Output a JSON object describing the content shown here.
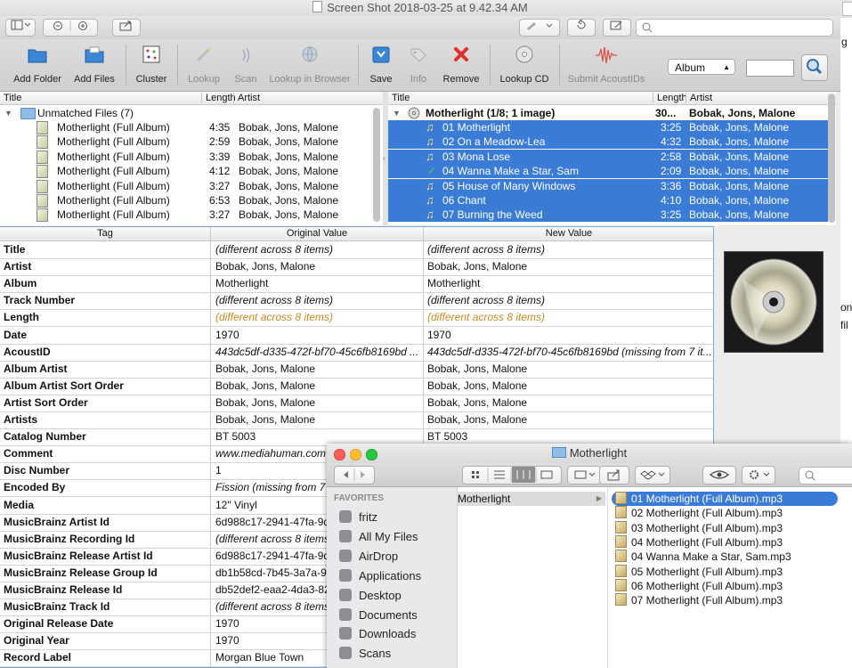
{
  "window": {
    "title": "Screen Shot 2018-03-25 at 9.42.34 AM"
  },
  "toolbar": {
    "add_folder": "Add Folder",
    "add_files": "Add Files",
    "cluster": "Cluster",
    "lookup": "Lookup",
    "scan": "Scan",
    "lookup_browser": "Lookup in Browser",
    "save": "Save",
    "info": "Info",
    "remove": "Remove",
    "lookup_cd": "Lookup CD",
    "submit": "Submit AcoustIDs",
    "album_select": "Album",
    "accent": "#3a7bd5"
  },
  "left_pane": {
    "col_title": "Title",
    "col_length": "Length",
    "col_artist": "Artist",
    "group": "Unmatched Files (7)",
    "rows": [
      {
        "title": "Motherlight (Full Album)",
        "length": "4:35",
        "artist": "Bobak, Jons, Malone"
      },
      {
        "title": "Motherlight (Full Album)",
        "length": "2:59",
        "artist": "Bobak, Jons, Malone"
      },
      {
        "title": "Motherlight (Full Album)",
        "length": "3:39",
        "artist": "Bobak, Jons, Malone"
      },
      {
        "title": "Motherlight (Full Album)",
        "length": "4:12",
        "artist": "Bobak, Jons, Malone"
      },
      {
        "title": "Motherlight (Full Album)",
        "length": "3:27",
        "artist": "Bobak, Jons, Malone"
      },
      {
        "title": "Motherlight (Full Album)",
        "length": "6:53",
        "artist": "Bobak, Jons, Malone"
      },
      {
        "title": "Motherlight (Full Album)",
        "length": "3:27",
        "artist": "Bobak, Jons, Malone"
      }
    ]
  },
  "right_pane": {
    "col_title": "Title",
    "col_length": "Length",
    "col_artist": "Artist",
    "album": {
      "title": "Motherlight (1/8; 1 image)",
      "length": "30...",
      "artist": "Bobak, Jons, Malone"
    },
    "tracks": [
      {
        "title": "01  Motherlight",
        "length": "3:25",
        "artist": "Bobak, Jons, Malone",
        "status": "note"
      },
      {
        "title": "02  On a Meadow-Lea",
        "length": "4:32",
        "artist": "Bobak, Jons, Malone",
        "status": "note"
      },
      {
        "title": "03  Mona Lose",
        "length": "2:58",
        "artist": "Bobak, Jons, Malone",
        "status": "note"
      },
      {
        "title": "04  Wanna Make a Star, Sam",
        "length": "2:09",
        "artist": "Bobak, Jons, Malone",
        "status": "check"
      },
      {
        "title": "05  House of Many Windows",
        "length": "3:36",
        "artist": "Bobak, Jons, Malone",
        "status": "note"
      },
      {
        "title": "06  Chant",
        "length": "4:10",
        "artist": "Bobak, Jons, Malone",
        "status": "note"
      },
      {
        "title": "07  Burning the Weed",
        "length": "3:25",
        "artist": "Bobak, Jons, Malone",
        "status": "note"
      }
    ]
  },
  "tag_table": {
    "col_tag": "Tag",
    "col_original": "Original Value",
    "col_new": "New Value",
    "rows": [
      {
        "tag": "Title",
        "original": "(different across 8 items)",
        "new": "(different across 8 items)",
        "style": "it"
      },
      {
        "tag": "Artist",
        "original": "Bobak, Jons, Malone",
        "new": "Bobak, Jons, Malone",
        "style": ""
      },
      {
        "tag": "Album",
        "original": "Motherlight",
        "new": "Motherlight",
        "style": ""
      },
      {
        "tag": "Track Number",
        "original": "(different across 8 items)",
        "new": "(different across 8 items)",
        "style": "it"
      },
      {
        "tag": "Length",
        "original": "(different across 8 items)",
        "new": "(different across 8 items)",
        "style": "it orange"
      },
      {
        "tag": "Date",
        "original": "1970",
        "new": "1970",
        "style": ""
      },
      {
        "tag": "AcoustID",
        "original": "443dc5df-d335-472f-bf70-45c6fb8169bd ...",
        "new": "443dc5df-d335-472f-bf70-45c6fb8169bd (missing from 7 it...",
        "style": "it"
      },
      {
        "tag": "Album Artist",
        "original": "Bobak, Jons, Malone",
        "new": "Bobak, Jons, Malone",
        "style": ""
      },
      {
        "tag": "Album Artist Sort Order",
        "original": "Bobak, Jons, Malone",
        "new": "Bobak, Jons, Malone",
        "style": ""
      },
      {
        "tag": "Artist Sort Order",
        "original": "Bobak, Jons, Malone",
        "new": "Bobak, Jons, Malone",
        "style": ""
      },
      {
        "tag": "Artists",
        "original": "Bobak, Jons, Malone",
        "new": "Bobak, Jons, Malone",
        "style": ""
      },
      {
        "tag": "Catalog Number",
        "original": "BT 5003",
        "new": "BT 5003",
        "style": ""
      },
      {
        "tag": "Comment",
        "original": "www.mediahuman.com",
        "new": "",
        "style": "it"
      },
      {
        "tag": "Disc Number",
        "original": "1",
        "new": "",
        "style": ""
      },
      {
        "tag": "Encoded By",
        "original": "Fission (missing from 7",
        "new": "",
        "style": "it"
      },
      {
        "tag": "Media",
        "original": "12\" Vinyl",
        "new": "",
        "style": ""
      },
      {
        "tag": "MusicBrainz Artist Id",
        "original": "6d988c17-2941-47fa-9d",
        "new": "",
        "style": ""
      },
      {
        "tag": "MusicBrainz Recording Id",
        "original": "(different across 8 items",
        "new": "",
        "style": "it"
      },
      {
        "tag": "MusicBrainz Release Artist Id",
        "original": "6d988c17-2941-47fa-9d",
        "new": "",
        "style": ""
      },
      {
        "tag": "MusicBrainz Release Group Id",
        "original": "db1b58cd-7b45-3a7a-9",
        "new": "",
        "style": ""
      },
      {
        "tag": "MusicBrainz Release Id",
        "original": "db52def2-eaa2-4da3-82",
        "new": "",
        "style": ""
      },
      {
        "tag": "MusicBrainz Track Id",
        "original": "(different across 8 items",
        "new": "",
        "style": "it"
      },
      {
        "tag": "Original Release Date",
        "original": "1970",
        "new": "",
        "style": ""
      },
      {
        "tag": "Original Year",
        "original": "1970",
        "new": "",
        "style": ""
      },
      {
        "tag": "Record Label",
        "original": "Morgan Blue Town",
        "new": "",
        "style": ""
      }
    ]
  },
  "background_window": {
    "fragments": [
      "g",
      "on",
      "fil"
    ]
  },
  "finder": {
    "title": "Motherlight",
    "favorites_header": "FAVORITES",
    "favorites": [
      "fritz",
      "All My Files",
      "AirDrop",
      "Applications",
      "Desktop",
      "Documents",
      "Downloads",
      "Scans"
    ],
    "folder": "Motherlight",
    "files": [
      "01  Motherlight (Full Album).mp3",
      "02  Motherlight (Full Album).mp3",
      "03  Motherlight (Full Album).mp3",
      "04  Motherlight (Full Album).mp3",
      "04 Wanna Make a Star, Sam.mp3",
      "05  Motherlight (Full Album).mp3",
      "06  Motherlight (Full Album).mp3",
      "07  Motherlight (Full Album).mp3"
    ]
  }
}
